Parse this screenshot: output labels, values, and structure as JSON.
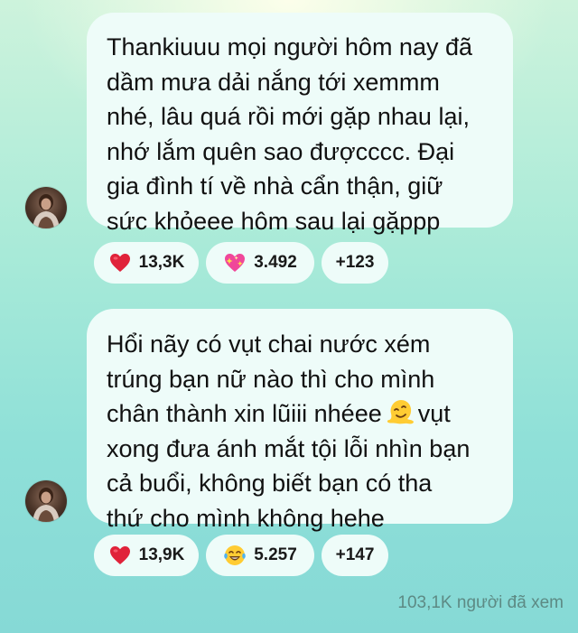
{
  "messages": [
    {
      "text": "Thankiuuu mọi người hôm nay đã\ndầm mưa dải nắng tới xemmm\nnhé, lâu quá rồi mới gặp nhau lại,\nnhớ lắm quên sao đượcccc. Đại\ngia đình tí về nhà cẩn thận, giữ\nsức khỏeee hôm sau lại gặppp",
      "reactions": [
        {
          "icon": "heart-icon",
          "count": "13,3K"
        },
        {
          "icon": "sparkling-heart-icon",
          "count": "3.492"
        },
        {
          "icon": "",
          "count": "+123"
        }
      ]
    },
    {
      "text_before_emoji": "Hổi nãy có vụt chai nước xém\ntrúng bạn nữ nào thì cho mình\nchân thành xin lũiii nhéee",
      "inline_emoji": "melting-face-icon",
      "text_after_emoji": "vụt\nxong đưa ánh mắt tội lỗi nhìn bạn\ncả buổi, không biết bạn có tha\nthứ cho mình không hehe",
      "reactions": [
        {
          "icon": "heart-icon",
          "count": "13,9K"
        },
        {
          "icon": "laughing-tears-icon",
          "count": "5.257"
        },
        {
          "icon": "",
          "count": "+147"
        }
      ]
    }
  ],
  "views_label": "103,1K người đã xem",
  "colors": {
    "bubble": "#eefcf9",
    "heart": "#e0233a",
    "text": "#111111",
    "views_text": "#5d8a84"
  }
}
